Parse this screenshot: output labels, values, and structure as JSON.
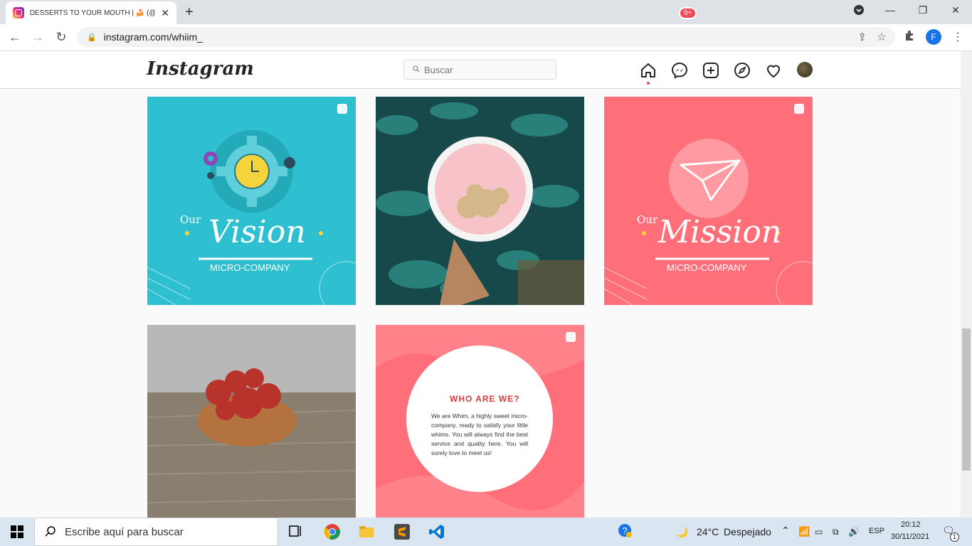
{
  "browser": {
    "tab_title": "DESSERTS TO YOUR MOUTH | 🍰 (@whiim_)",
    "url": "instagram.com/whiim_",
    "profile_initial": "F"
  },
  "instagram": {
    "logo": "Instagram",
    "search_placeholder": "Buscar",
    "messages_badge": "9+"
  },
  "posts": [
    {
      "label_small": "Our",
      "label_big": "Vision",
      "label_sub": "MICRO-COMPANY",
      "bg": "#2ec0d0"
    },
    {
      "alt": "bowl-with-oats-photo",
      "bg": "#1f5a5a"
    },
    {
      "label_small": "Our",
      "label_big": "Mission",
      "label_sub": "MICRO-COMPANY",
      "bg": "#ff6f7a"
    },
    {
      "alt": "strawberries-bowl-photo",
      "bg": "#9a9a9a"
    },
    {
      "title": "WHO ARE WE?",
      "body": "We are Whim, a highly sweet micro-company, ready to satisfy your little whims. You will always find the best service and quality here. You will surely love to meet us!",
      "bg": "#ff6f7a"
    }
  ],
  "taskbar": {
    "search_text": "Escribe aquí para buscar",
    "weather": "24°C",
    "weather_desc": "Despejado",
    "lang": "ESP",
    "time": "20:12",
    "date": "30/11/2021",
    "notif_count": "1"
  }
}
